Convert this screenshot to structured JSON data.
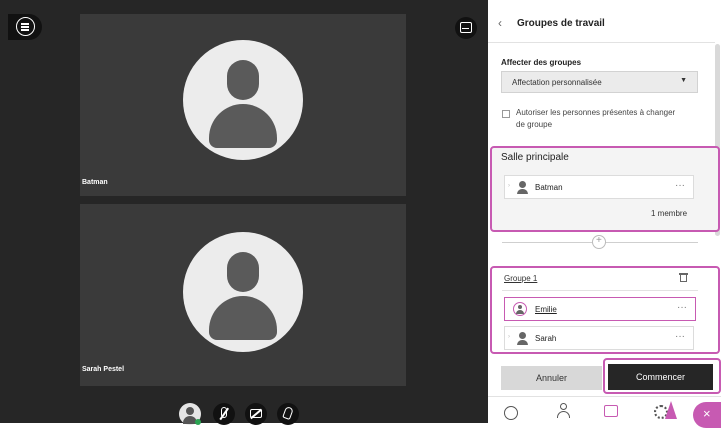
{
  "stage": {
    "participants": [
      {
        "name": "Batman"
      },
      {
        "name": "Sarah Pestel"
      }
    ]
  },
  "panel": {
    "title": "Groupes de travail",
    "assign_label": "Affecter des groupes",
    "assign_value": "Affectation personnalisée",
    "allow_switch_label": "Autoriser les personnes présentes à changer de groupe",
    "main_room": {
      "title": "Salle principale",
      "members": [
        "Batman"
      ],
      "count": "1 membre"
    },
    "group1": {
      "title": "Groupe 1",
      "members": [
        "Emilie",
        "Sarah"
      ]
    },
    "cancel_label": "Annuler",
    "start_label": "Commencer"
  },
  "icons": {
    "menu": "menu-icon",
    "layout": "layout-icon",
    "back": "chevron-left-icon",
    "dropdown": "caret-down-icon",
    "user": "user-icon",
    "more": "more-icon",
    "add": "plus-icon",
    "trash": "trash-icon",
    "chat": "chat-icon",
    "participants": "participants-icon",
    "share": "share-icon",
    "settings": "gear-icon",
    "close": "close-icon",
    "mic_off": "mic-off-icon",
    "camera_off": "camera-off-icon",
    "raise_hand": "raise-hand-icon"
  },
  "colors": {
    "accent": "#c75ab2",
    "stage_bg": "#262626",
    "tile_bg": "#3a3a3a",
    "primary_button": "#262626"
  }
}
